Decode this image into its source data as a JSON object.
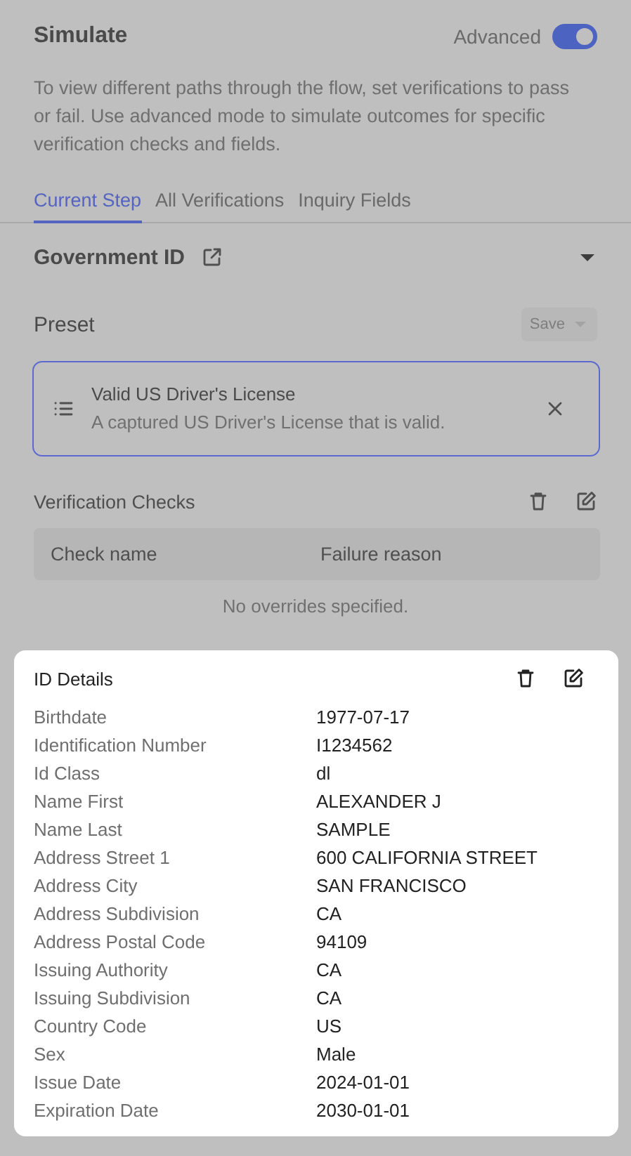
{
  "header": {
    "title": "Simulate",
    "toggle": {
      "label": "Advanced",
      "on": true
    }
  },
  "description": "To view different paths through the flow, set verifications to pass or fail. Use advanced mode to simulate outcomes for specific verification checks and fields.",
  "tabs": [
    {
      "label": "Current Step",
      "selected": true
    },
    {
      "label": "All Verifications",
      "selected": false
    },
    {
      "label": "Inquiry Fields",
      "selected": false
    }
  ],
  "section": {
    "title": "Government ID",
    "expanded": true
  },
  "preset": {
    "label": "Preset",
    "save_button": {
      "label": "Save",
      "disabled": true
    },
    "item": {
      "title": "Valid US Driver's License",
      "subtitle": "A captured US Driver's License that is valid.",
      "selected": true
    }
  },
  "verification_checks": {
    "title": "Verification Checks",
    "columns": [
      "Check name",
      "Failure reason"
    ],
    "empty_text": "No overrides specified."
  },
  "id_details": {
    "title": "ID Details",
    "rows": [
      {
        "label": "Birthdate",
        "value": "1977-07-17"
      },
      {
        "label": "Identification Number",
        "value": "I1234562"
      },
      {
        "label": "Id Class",
        "value": "dl"
      },
      {
        "label": "Name First",
        "value": "ALEXANDER J"
      },
      {
        "label": "Name Last",
        "value": "SAMPLE"
      },
      {
        "label": "Address Street 1",
        "value": "600 CALIFORNIA STREET"
      },
      {
        "label": "Address City",
        "value": "SAN FRANCISCO"
      },
      {
        "label": "Address Subdivision",
        "value": "CA"
      },
      {
        "label": "Address Postal Code",
        "value": "94109"
      },
      {
        "label": "Issuing Authority",
        "value": "CA"
      },
      {
        "label": "Issuing Subdivision",
        "value": "CA"
      },
      {
        "label": "Country Code",
        "value": "US"
      },
      {
        "label": "Sex",
        "value": "Male"
      },
      {
        "label": "Issue Date",
        "value": "2024-01-01"
      },
      {
        "label": "Expiration Date",
        "value": "2030-01-01"
      }
    ]
  }
}
